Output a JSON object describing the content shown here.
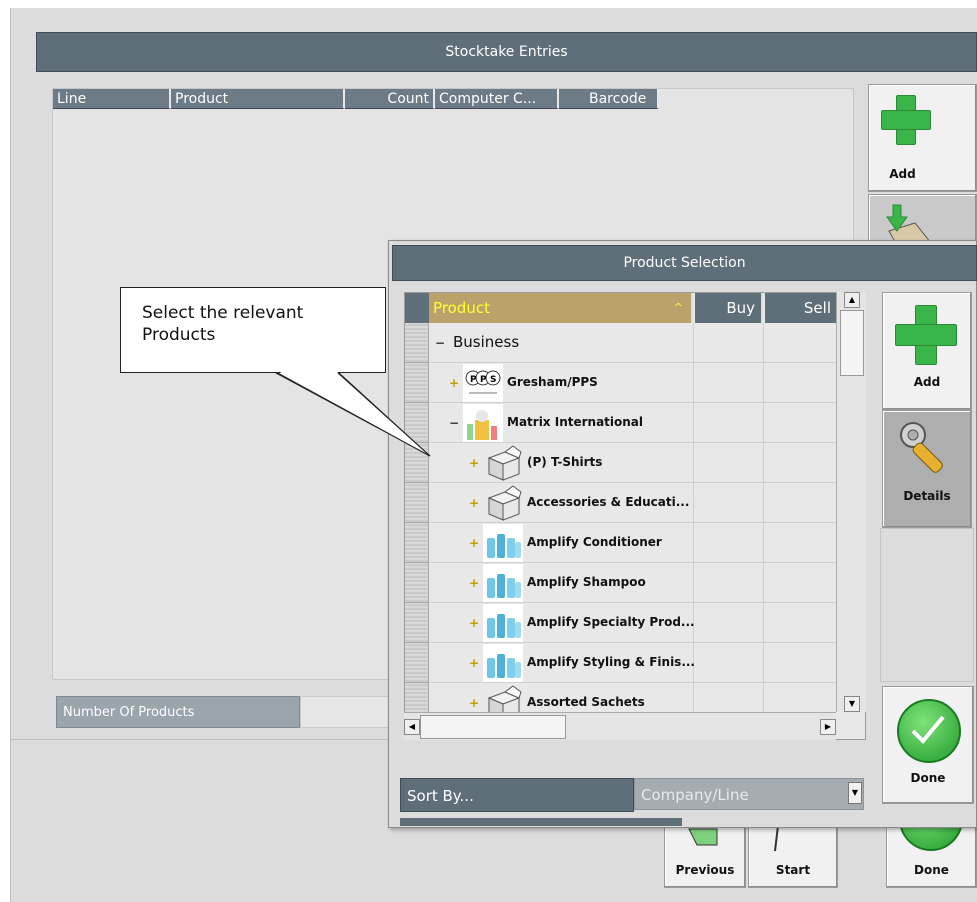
{
  "main_window": {
    "title": "Stocktake Entries",
    "columns": [
      "Line",
      "Product",
      "Count",
      "Computer C...",
      "Barcode"
    ],
    "number_of_products_label": "Number Of Products",
    "number_of_products_value": "",
    "side_buttons": {
      "add_label": "Add"
    },
    "bottom_buttons": {
      "previous_label": "Previous",
      "start_label": "Start",
      "done_label": "Done"
    }
  },
  "dialog": {
    "title": "Product Selection",
    "columns": {
      "product": "Product",
      "buy": "Buy",
      "sell": "Sell"
    },
    "tree_rows": [
      {
        "label": "Business",
        "expander": "−",
        "level": 0,
        "icon": "none"
      },
      {
        "label": "Gresham/PPS",
        "expander": "+",
        "level": 1,
        "icon": "pps-logo-icon"
      },
      {
        "label": "Matrix International",
        "expander": "−",
        "level": 1,
        "icon": "matrix-logo-icon"
      },
      {
        "label": "(P) T-Shirts",
        "expander": "+",
        "level": 2,
        "icon": "box-icon"
      },
      {
        "label": "Accessories & Educati...",
        "expander": "+",
        "level": 2,
        "icon": "box-icon"
      },
      {
        "label": "Amplify Conditioner",
        "expander": "+",
        "level": 2,
        "icon": "bottles-icon"
      },
      {
        "label": "Amplify Shampoo",
        "expander": "+",
        "level": 2,
        "icon": "bottles-icon"
      },
      {
        "label": "Amplify Specialty Prod...",
        "expander": "+",
        "level": 2,
        "icon": "bottles-icon"
      },
      {
        "label": "Amplify Styling & Finis...",
        "expander": "+",
        "level": 2,
        "icon": "bottles-icon"
      },
      {
        "label": "Assorted Sachets",
        "expander": "+",
        "level": 2,
        "icon": "box-icon"
      }
    ],
    "side_buttons": {
      "add_label": "Add",
      "details_label": "Details",
      "done_label": "Done"
    },
    "sort_by_label": "Sort By...",
    "sort_by_value": "Company/Line",
    "sort_header_indicator": "^"
  },
  "callout": {
    "line1": "Select the relevant",
    "line2": "Products"
  },
  "colors": {
    "header": "#5f6f7a",
    "product_header": "#b9a36a",
    "product_header_text": "#ffff33",
    "accent_green": "#39b54a"
  }
}
